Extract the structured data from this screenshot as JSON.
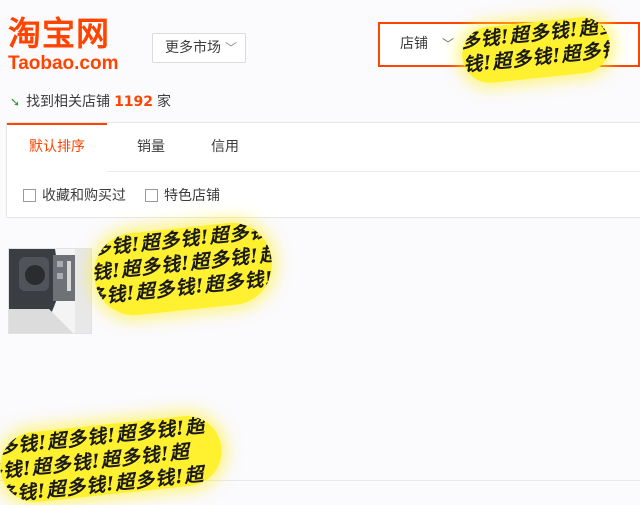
{
  "header": {
    "logo_cn": "淘宝网",
    "logo_en": "Taobao.com",
    "more_markets_label": "更多市场"
  },
  "search": {
    "type_label": "店铺",
    "value": ""
  },
  "results": {
    "prefix": "找到相关店铺",
    "count": "1192",
    "suffix": "家"
  },
  "tabs": [
    "默认排序",
    "销量",
    "信用"
  ],
  "filters": [
    "收藏和购买过",
    "特色店铺"
  ],
  "watermark": {
    "text": "多钱!超多钱!超多钱!超",
    "color": "#fff030"
  },
  "colors": {
    "accent": "#ff4400"
  }
}
